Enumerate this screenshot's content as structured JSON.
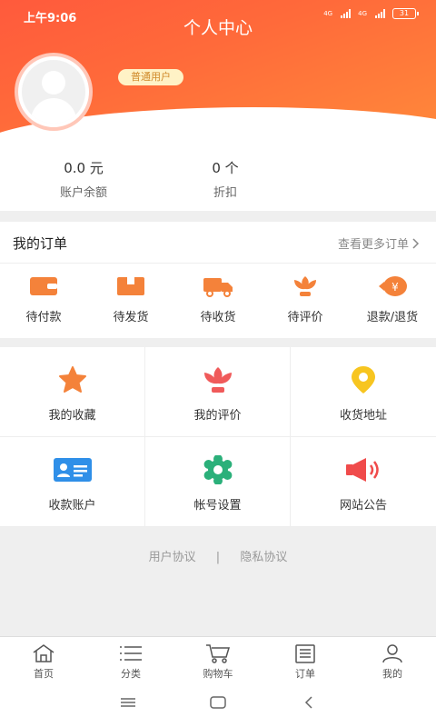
{
  "status_bar": {
    "time": "上午9:06",
    "sig1": "4G",
    "sig2": "4G",
    "battery": "31"
  },
  "header": {
    "title": "个人中心",
    "user_level": "普通用户"
  },
  "stats": [
    {
      "value": "0.0 元",
      "label": "账户余额"
    },
    {
      "value": "0 个",
      "label": "折扣"
    }
  ],
  "orders": {
    "title": "我的订单",
    "more": "查看更多订单",
    "items": [
      {
        "label": "待付款",
        "icon": "wallet-icon"
      },
      {
        "label": "待发货",
        "icon": "package-icon"
      },
      {
        "label": "待收货",
        "icon": "truck-icon"
      },
      {
        "label": "待评价",
        "icon": "flower-icon"
      },
      {
        "label": "退款/退货",
        "icon": "refund-icon"
      }
    ]
  },
  "grid": [
    {
      "label": "我的收藏",
      "icon": "star-icon"
    },
    {
      "label": "我的评价",
      "icon": "flower-icon"
    },
    {
      "label": "收货地址",
      "icon": "location-pin-icon"
    },
    {
      "label": "收款账户",
      "icon": "id-card-icon"
    },
    {
      "label": "帐号设置",
      "icon": "gear-icon"
    },
    {
      "label": "网站公告",
      "icon": "megaphone-icon"
    }
  ],
  "links": {
    "agreement": "用户协议",
    "separator": "|",
    "privacy": "隐私协议"
  },
  "tabbar": [
    {
      "label": "首页",
      "icon": "home-icon"
    },
    {
      "label": "分类",
      "icon": "list-icon"
    },
    {
      "label": "购物车",
      "icon": "cart-icon"
    },
    {
      "label": "订单",
      "icon": "clipboard-icon"
    },
    {
      "label": "我的",
      "icon": "user-icon"
    }
  ],
  "colors": {
    "accent": "#ff6a3a",
    "orange": "#f4823a",
    "red": "#f04b4b",
    "yellow": "#f7c520",
    "blue": "#2f8fe8",
    "green": "#2bb07a"
  }
}
